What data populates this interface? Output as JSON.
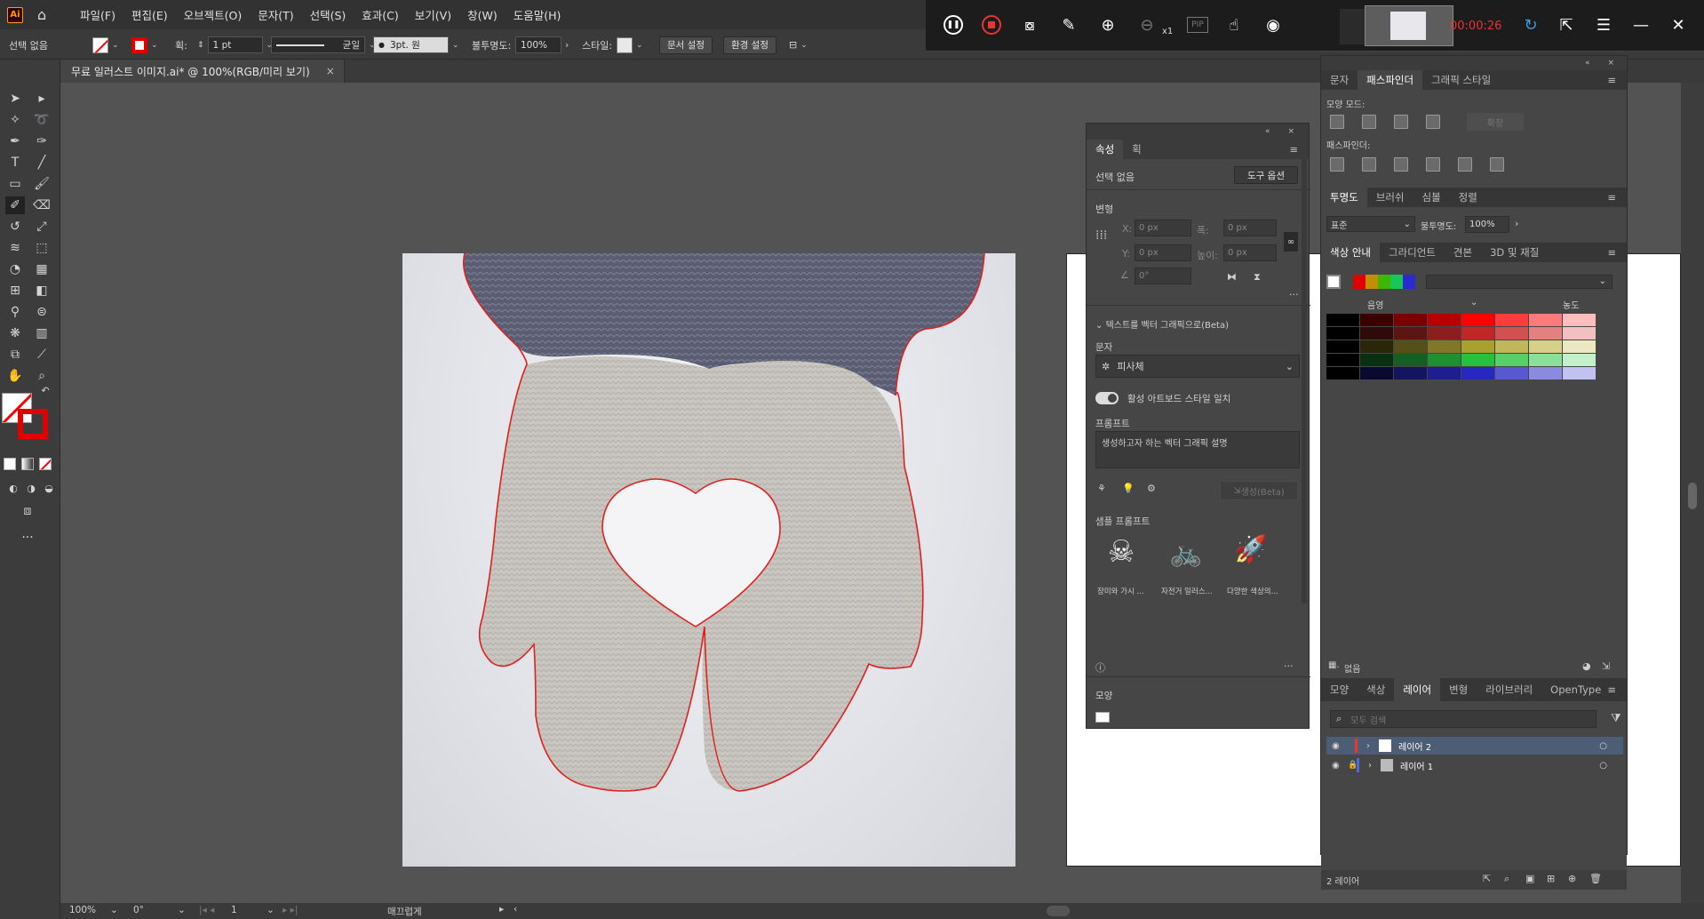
{
  "menu": {
    "app_logo": "Ai",
    "items": [
      "파일(F)",
      "편집(E)",
      "오브젝트(O)",
      "문자(T)",
      "선택(S)",
      "효과(C)",
      "보기(V)",
      "창(W)",
      "도움말(H)"
    ]
  },
  "control_bar": {
    "selection": "선택 없음",
    "stroke_label": "획:",
    "stroke_weight": "1 pt",
    "stroke_style": "균일",
    "brush": "3pt. 원",
    "opacity_label": "불투명도:",
    "opacity": "100%",
    "style_label": "스타일:",
    "doc_setup": "문서 설정",
    "prefs": "환경 설정"
  },
  "recorder": {
    "timer": "00:00:26",
    "zoom_label": "x1",
    "pip": "PIP"
  },
  "doc_tab": {
    "title": "무료 일러스트 이미지.ai* @ 100%(RGB/미리 보기)",
    "close": "×"
  },
  "properties": {
    "tabs": [
      "속성",
      "획"
    ],
    "no_selection": "선택 없음",
    "tool_options": "도구 옵션",
    "transform": "변형",
    "x_label": "X:",
    "x_val": "0 px",
    "w_label": "폭:",
    "w_val": "0 px",
    "y_label": "Y:",
    "y_val": "0 px",
    "h_label": "높이:",
    "h_val": "0 px",
    "angle_val": "0°",
    "ttv_title": "텍스트를 벡터 그래픽으로(Beta)",
    "type_label": "문자",
    "subject": "피사체",
    "match_style": "활성 아트보드 스타일 일치",
    "prompt_label": "프롬프트",
    "prompt_placeholder": "생성하고자 하는 벡터 그래픽 설명",
    "generate": "생성(Beta)",
    "samples_label": "샘플 프롬프트",
    "samples": [
      "장미와 가시 ...",
      "자전거 일러스...",
      "다양한 색상의..."
    ],
    "appearance": "모양"
  },
  "pathfinder": {
    "tabs": [
      "문자",
      "패스파인더",
      "그래픽 스타일"
    ],
    "shape_modes": "모양 모드:",
    "expand": "확장",
    "pathfinders": "패스파인더:"
  },
  "transparency": {
    "tabs": [
      "투명도",
      "브러쉬",
      "심볼",
      "정렬"
    ],
    "blend": "표준",
    "opacity_label": "불투명도:",
    "opacity": "100%"
  },
  "color_guide": {
    "tabs": [
      "색상 안내",
      "그라디언트",
      "견본",
      "3D 및 재질"
    ],
    "shade": "음영",
    "tint": "농도",
    "none": "없음",
    "swatch_rows": [
      [
        "#000000",
        "#3a0000",
        "#7a0000",
        "#b80000",
        "#ff0000",
        "#ff3b3b",
        "#ff7a7a",
        "#ffbdbd"
      ],
      [
        "#000000",
        "#2e0a0a",
        "#5e1414",
        "#8e1e1e",
        "#c02828",
        "#d25050",
        "#e38080",
        "#f2c0c0"
      ],
      [
        "#000000",
        "#2a2608",
        "#55501a",
        "#807828",
        "#aaa030",
        "#c0b858",
        "#d6d08a",
        "#ece8c2"
      ],
      [
        "#000000",
        "#0a3012",
        "#146024",
        "#1e9030",
        "#28c040",
        "#58d068",
        "#8ae098",
        "#c2f0ca"
      ],
      [
        "#000000",
        "#0a0a30",
        "#141460",
        "#1e1e90",
        "#2828c0",
        "#5858d0",
        "#8a8ae0",
        "#c2c2f0"
      ]
    ],
    "harmony": [
      "#ffffff",
      "#e00000",
      "#c09000",
      "#3cb800",
      "#16c85a",
      "#2a2ad0"
    ]
  },
  "layers": {
    "tabs": [
      "모양",
      "색상",
      "레이어",
      "변형",
      "라이브러리",
      "OpenType"
    ],
    "search_placeholder": "모두 검색",
    "items": [
      "레이어 2",
      "레이어 1"
    ],
    "count": "2 레이어"
  },
  "status": {
    "zoom": "100%",
    "rotation": "0°",
    "artboard": "1",
    "tool": "매끄럽게"
  }
}
